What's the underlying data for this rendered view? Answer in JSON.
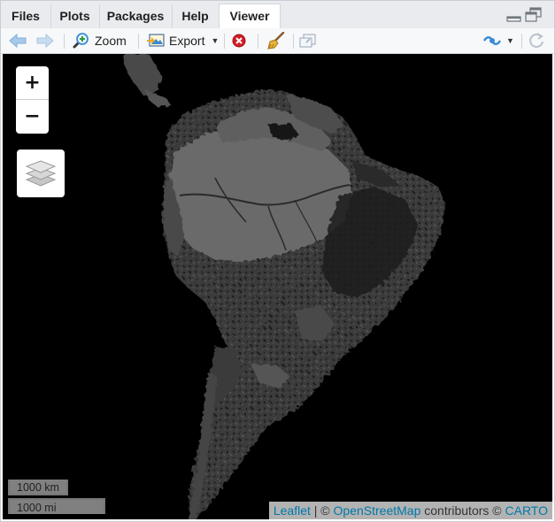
{
  "tabs": [
    {
      "label": "Files"
    },
    {
      "label": "Plots"
    },
    {
      "label": "Packages"
    },
    {
      "label": "Help"
    },
    {
      "label": "Viewer"
    }
  ],
  "active_tab": "Viewer",
  "toolbar": {
    "back_icon": "back-arrow-icon",
    "forward_icon": "forward-arrow-icon",
    "zoom_label": "Zoom",
    "export_label": "Export",
    "remove_icon": "remove-viewer-icon",
    "clear_icon": "broom-icon",
    "popout_icon": "show-in-new-window-icon",
    "publish_icon": "publish-icon",
    "refresh_icon": "refresh-icon"
  },
  "map": {
    "zoom_in_label": "+",
    "zoom_out_label": "−",
    "layers_icon": "layers-icon",
    "scale_km": "1000 km",
    "scale_mi": "1000 mi",
    "attribution": {
      "leaflet": "Leaflet",
      "sep1": " | © ",
      "osm": "OpenStreetMap",
      "contributors": " contributors © ",
      "carto": "CARTO"
    }
  },
  "colors": {
    "map_background": "#000000",
    "land_fill": "#5a5a5a",
    "link": "#0078a8",
    "toolbar_blue": "#3b8bd6"
  }
}
